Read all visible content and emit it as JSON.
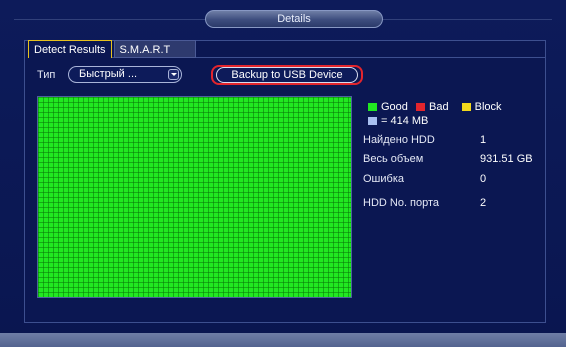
{
  "window": {
    "title": "Details"
  },
  "tabs": [
    {
      "label": "Detect Results",
      "active": true
    },
    {
      "label": "S.M.A.R.T",
      "active": false
    }
  ],
  "type_field": {
    "label": "Тип",
    "value": "Быстрый ..."
  },
  "backup_button": {
    "label": "Backup to USB Device"
  },
  "legend": {
    "good": {
      "label": "Good",
      "color": "#21e821"
    },
    "bad": {
      "label": "Bad",
      "color": "#e3252d"
    },
    "block": {
      "label": "Block",
      "color": "#f2d81c"
    },
    "unit": {
      "label": "= 414 MB",
      "color": "#a8bff0"
    }
  },
  "info": [
    {
      "label": "Найдено HDD",
      "value": "1"
    },
    {
      "label": "Весь объем",
      "value": "931.51 GB"
    },
    {
      "label": "Ошибка",
      "value": "0"
    },
    {
      "label": "HDD No. порта",
      "value": "2"
    }
  ],
  "colors": {
    "accent_tab": "#e7c21e",
    "highlight": "#e3252d",
    "background": "#0a1650"
  }
}
